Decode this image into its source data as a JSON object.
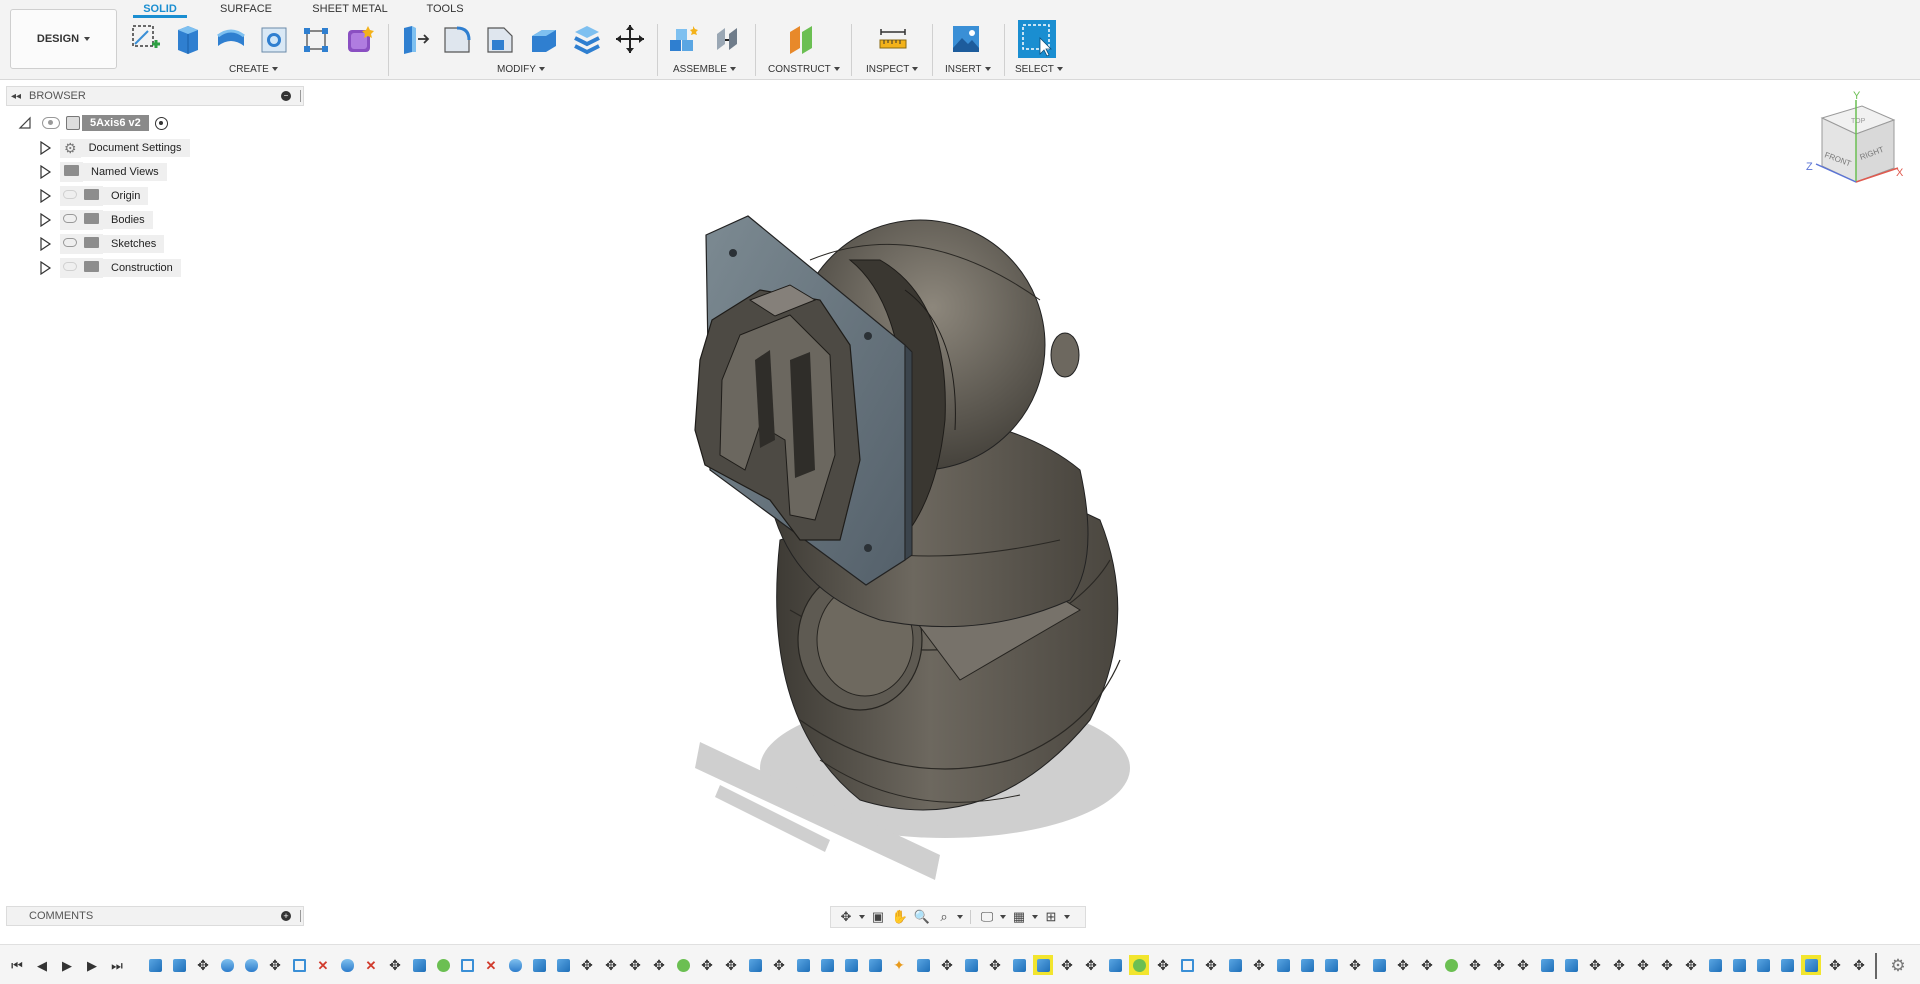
{
  "toolbar": {
    "workspace_button": "DESIGN",
    "tabs": [
      {
        "label": "SOLID",
        "active": true
      },
      {
        "label": "SURFACE",
        "active": false
      },
      {
        "label": "SHEET METAL",
        "active": false
      },
      {
        "label": "TOOLS",
        "active": false
      }
    ],
    "groups": [
      {
        "label": "CREATE"
      },
      {
        "label": "MODIFY"
      },
      {
        "label": "ASSEMBLE"
      },
      {
        "label": "CONSTRUCT"
      },
      {
        "label": "INSPECT"
      },
      {
        "label": "INSERT"
      },
      {
        "label": "SELECT"
      }
    ]
  },
  "browser": {
    "title": "BROWSER",
    "root": {
      "label": "5Axis6 v2"
    },
    "items": [
      {
        "label": "Document Settings",
        "icon": "gear-icon"
      },
      {
        "label": "Named Views",
        "icon": "folder-icon"
      },
      {
        "label": "Origin",
        "icon": "folder-icon"
      },
      {
        "label": "Bodies",
        "icon": "folder-icon"
      },
      {
        "label": "Sketches",
        "icon": "folder-icon"
      },
      {
        "label": "Construction",
        "icon": "folder-icon"
      }
    ]
  },
  "comments": {
    "title": "COMMENTS"
  },
  "viewcube": {
    "axis_x": "X",
    "axis_y": "Y",
    "axis_z": "Z",
    "face_front": "FRONT",
    "face_right": "RIGHT",
    "face_top": "TOP"
  },
  "colors": {
    "accent": "#1a8ed1",
    "model": "#5e5a52",
    "highlight": "#f2e52e"
  }
}
